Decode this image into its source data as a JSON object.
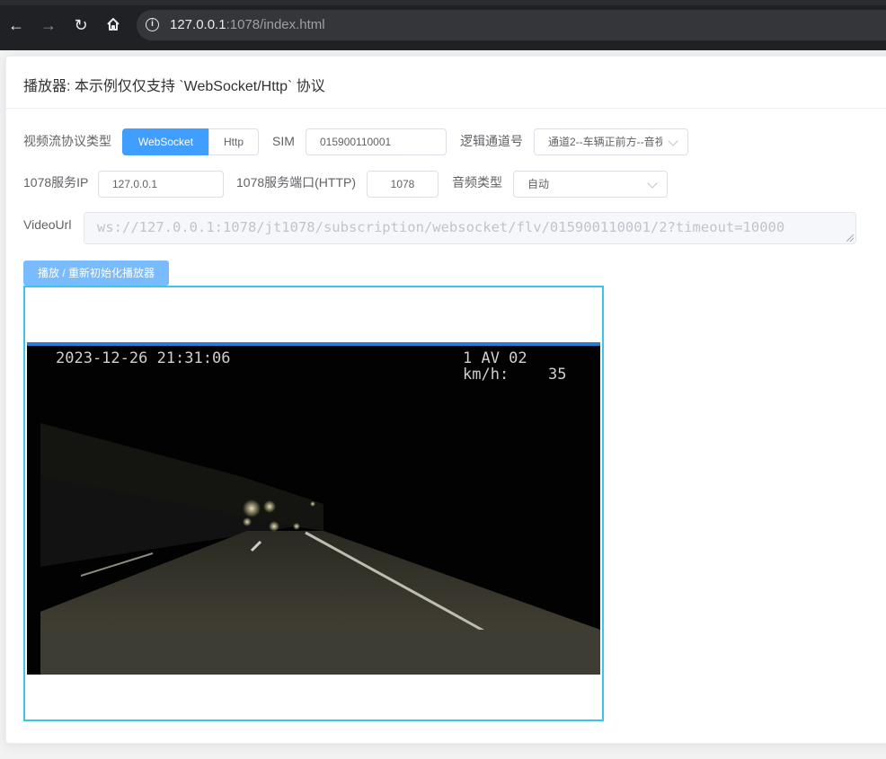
{
  "browser": {
    "url_host": "127.0.0.1",
    "url_rest": ":1078/index.html",
    "back_icon": "back-arrow-icon",
    "forward_icon": "forward-arrow-icon",
    "reload_icon": "reload-icon",
    "home_icon": "home-icon",
    "info_icon": "info-icon"
  },
  "card": {
    "title": "播放器: 本示例仅仅支持 `WebSocket/Http` 协议"
  },
  "form": {
    "protocol_label": "视频流协议类型",
    "protocol_options": [
      "WebSocket",
      "Http"
    ],
    "protocol_selected": "WebSocket",
    "sim_label": "SIM",
    "sim_value": "015900110001",
    "channel_label": "逻辑通道号",
    "channel_value": "通道2--车辆正前方--音视",
    "server_ip_label": "1078服务IP",
    "server_ip_value": "127.0.0.1",
    "server_port_label": "1078服务端口(HTTP)",
    "server_port_value": "1078",
    "audio_label": "音频类型",
    "audio_value": "自动",
    "video_url_label": "VideoUrl",
    "video_url_value": "ws://127.0.0.1:1078/jt1078/subscription/websocket/flv/015900110001/2?timeout=10000",
    "init_button": "播放 / 重新初始化播放器"
  },
  "player": {
    "osd_datetime": "2023-12-26 21:31:06",
    "osd_channel": "1 AV 02",
    "osd_speed_label": "km/h:",
    "osd_speed_value": "35",
    "accent_color": "#3ac6ea"
  }
}
